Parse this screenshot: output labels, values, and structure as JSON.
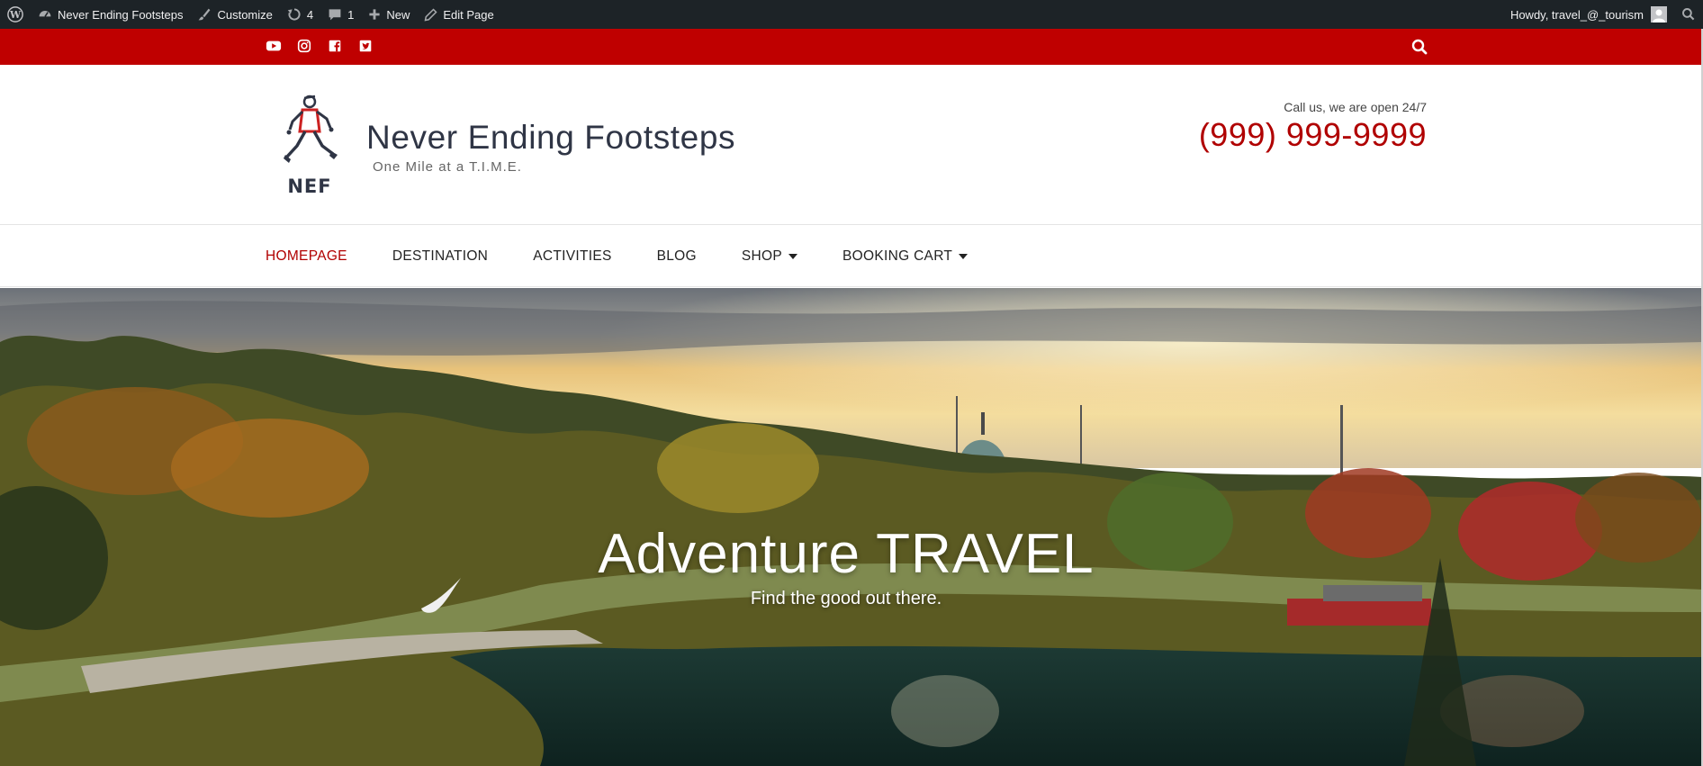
{
  "admin_bar": {
    "site_name": "Never Ending Footsteps",
    "customize": "Customize",
    "updates_count": "4",
    "comments_count": "1",
    "new": "New",
    "edit_page": "Edit Page",
    "howdy": "Howdy, travel_@_tourism"
  },
  "social_icons": [
    "youtube-icon",
    "instagram-icon",
    "facebook-icon",
    "twitter-icon"
  ],
  "header": {
    "logo_text": "NEF",
    "site_title": "Never Ending Footsteps",
    "tagline": "One Mile at a T.I.M.E.",
    "call_text": "Call us, we are open 24/7",
    "phone": "(999) 999-9999"
  },
  "nav": {
    "items": [
      {
        "label": "HOMEPAGE",
        "active": true
      },
      {
        "label": "DESTINATION"
      },
      {
        "label": "ACTIVITIES"
      },
      {
        "label": "BLOG"
      },
      {
        "label": "SHOP",
        "dropdown": true
      },
      {
        "label": "BOOKING CART",
        "dropdown": true
      }
    ]
  },
  "hero": {
    "title": "Adventure TRAVEL",
    "subtitle": "Find the good out there."
  },
  "colors": {
    "admin_bar": "#1d2327",
    "top_bar": "#bf0000",
    "accent": "#b00000",
    "title_text": "#2f3545"
  }
}
